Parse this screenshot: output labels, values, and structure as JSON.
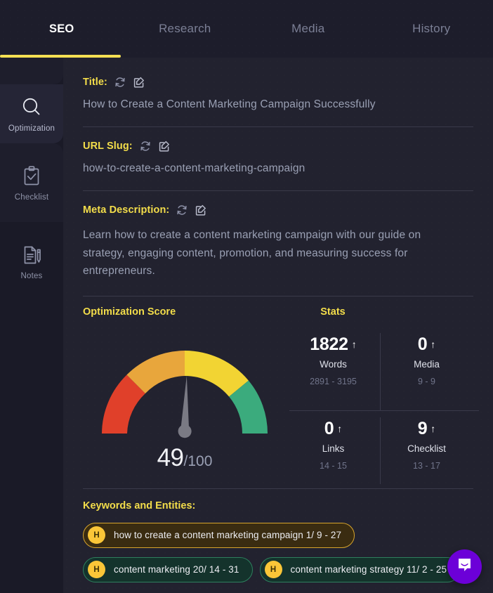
{
  "nav": {
    "tabs": [
      {
        "label": "SEO",
        "active": true
      },
      {
        "label": "Research",
        "active": false
      },
      {
        "label": "Media",
        "active": false
      },
      {
        "label": "History",
        "active": false
      }
    ],
    "accent_color": "#f5e053"
  },
  "sidebar": {
    "items": [
      {
        "label": "Optimization",
        "icon": "magnifier-icon",
        "active": true
      },
      {
        "label": "Checklist",
        "icon": "clipboard-check-icon",
        "active": false
      },
      {
        "label": "Notes",
        "icon": "document-pen-icon",
        "active": false
      }
    ]
  },
  "fields": {
    "title": {
      "label": "Title:",
      "value": "How to Create a Content Marketing Campaign Successfully",
      "refresh_icon": "refresh-icon",
      "edit_icon": "edit-pencil-icon"
    },
    "slug": {
      "label": "URL Slug:",
      "value": "how-to-create-a-content-marketing-campaign",
      "refresh_icon": "refresh-icon",
      "edit_icon": "edit-pencil-icon"
    },
    "meta": {
      "label": "Meta Description:",
      "value": "Learn how to create a content marketing campaign with our guide on strategy, engaging content, promotion, and measuring success for entrepreneurs.",
      "refresh_icon": "refresh-icon",
      "edit_icon": "edit-pencil-icon"
    }
  },
  "score": {
    "title": "Optimization Score",
    "value": "49",
    "out_of": "/100"
  },
  "stats": {
    "title": "Stats",
    "cells": [
      {
        "value": "1822",
        "arrow": "↑",
        "name": "Words",
        "range": "2891 - 3195"
      },
      {
        "value": "0",
        "arrow": "↑",
        "name": "Media",
        "range": "9 - 9"
      },
      {
        "value": "0",
        "arrow": "↑",
        "name": "Links",
        "range": "14 - 15"
      },
      {
        "value": "9",
        "arrow": "↑",
        "name": "Checklist",
        "range": "13 - 17"
      }
    ]
  },
  "keywords": {
    "title": "Keywords and Entities:",
    "items": [
      {
        "badge": "H",
        "text": "how to create a content marketing campaign 1/ 9 - 27",
        "variant": "amber"
      },
      {
        "badge": "H",
        "text": "content marketing 20/ 14 - 31",
        "variant": "green"
      },
      {
        "badge": "H",
        "text": "content marketing strategy 11/ 2 - 25",
        "variant": "green"
      }
    ]
  },
  "intercom": {
    "label": "intercom-messenger",
    "color": "#6c00d8"
  },
  "chart_data": {
    "type": "gauge",
    "title": "Optimization Score",
    "value": 49,
    "min": 0,
    "max": 100,
    "needle_angle_deg": 88,
    "segments": [
      {
        "name": "poor",
        "from": 0,
        "to": 25,
        "color": "#e0402a"
      },
      {
        "name": "fair",
        "from": 25,
        "to": 50,
        "color": "#e8a63c"
      },
      {
        "name": "good",
        "from": 50,
        "to": 78,
        "color": "#f2d433"
      },
      {
        "name": "excellent",
        "from": 78,
        "to": 100,
        "color": "#3bab7d"
      }
    ],
    "needle_color": "#7a7a84",
    "label": "49/100"
  }
}
